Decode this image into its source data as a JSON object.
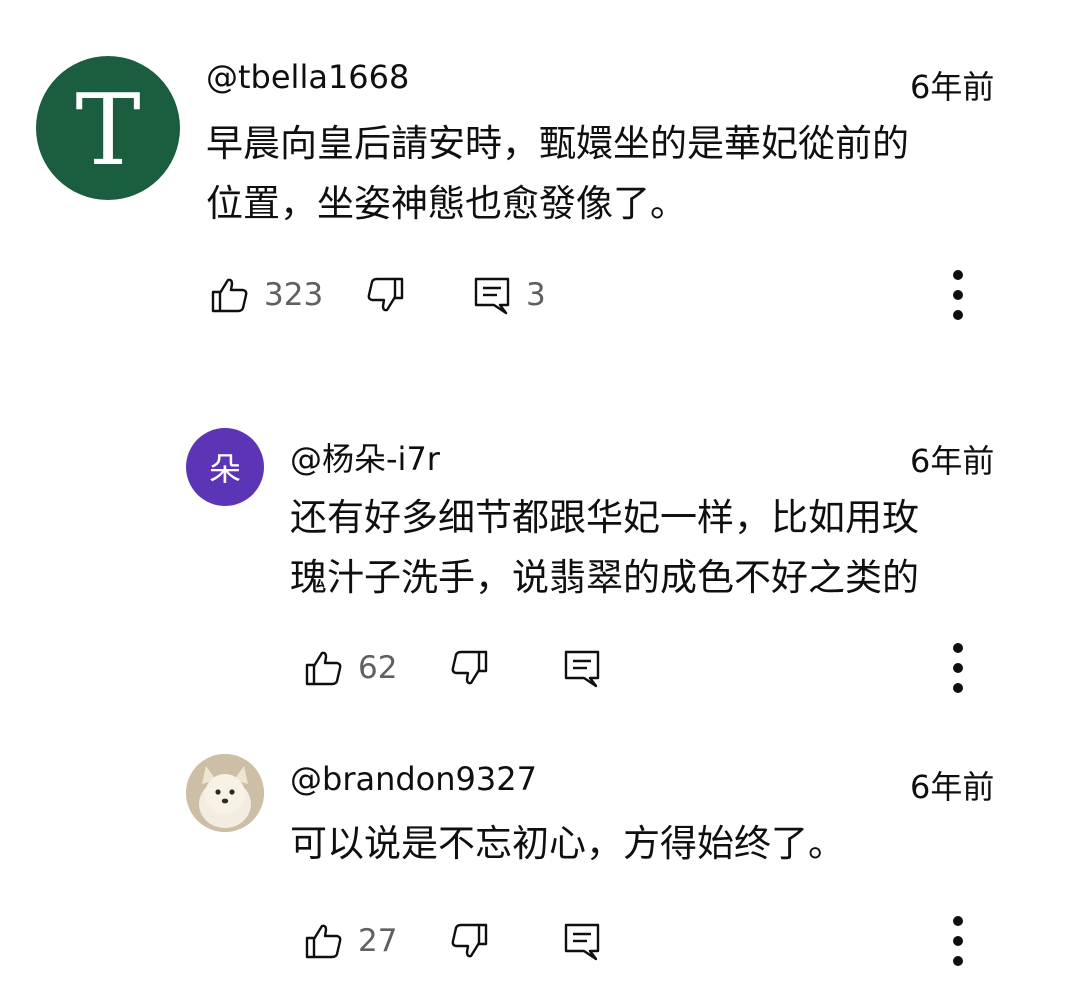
{
  "comments": [
    {
      "avatar": {
        "letter": "T",
        "bg": "#1b5e3f",
        "fg": "#ffffff"
      },
      "handle": "@tbella1668",
      "time": "6年前",
      "lines": [
        "早晨向皇后請安時，甄嬛坐的是華妃從前的",
        "位置，坐姿神態也愈發像了。"
      ],
      "likes": "323",
      "replies": "3"
    },
    {
      "avatar": {
        "letter": "朵",
        "bg": "#5b35b5",
        "fg": "#ffffff"
      },
      "handle": "@杨朵-i7r",
      "time": "6年前",
      "lines": [
        "还有好多细节都跟华妃一样，比如用玫",
        "瑰汁子洗手，说翡翠的成色不好之类的"
      ],
      "likes": "62"
    },
    {
      "avatar": {
        "type": "photo",
        "bg": "#d8cbb4"
      },
      "handle": "@brandon9327",
      "time": "6年前",
      "lines": [
        "可以说是不忘初心，方得始终了。"
      ],
      "likes": "27"
    }
  ],
  "icons": [
    "thumbs-up-icon",
    "thumbs-down-icon",
    "reply-icon",
    "more-vertical-icon"
  ]
}
